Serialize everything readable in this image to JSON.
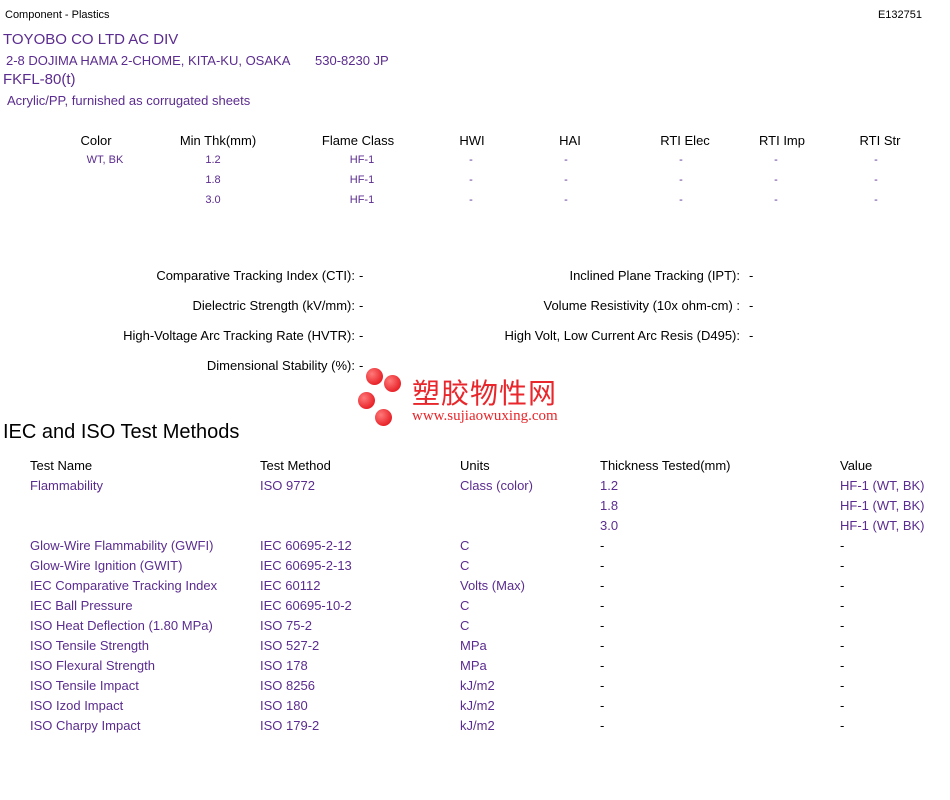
{
  "header": {
    "category": "Component - Plastics",
    "file_number": "E132751",
    "company": "TOYOBO CO LTD AC DIV",
    "address": "2-8 DOJIMA HAMA 2-CHOME, KITA-KU, OSAKA",
    "postal": "530-8230 JP",
    "product": "FKFL-80(t)",
    "description": "Acrylic/PP, furnished as corrugated sheets"
  },
  "ratings_table": {
    "headers": [
      "Color",
      "Min Thk(mm)",
      "Flame Class",
      "HWI",
      "HAI",
      "RTI Elec",
      "RTI Imp",
      "RTI Str"
    ],
    "rows": [
      [
        "WT, BK",
        "1.2",
        "HF-1",
        "-",
        "-",
        "-",
        "-",
        "-"
      ],
      [
        "",
        "1.8",
        "HF-1",
        "-",
        "-",
        "-",
        "-",
        "-"
      ],
      [
        "",
        "3.0",
        "HF-1",
        "-",
        "-",
        "-",
        "-",
        "-"
      ]
    ]
  },
  "properties": {
    "left": [
      {
        "label": "Comparative Tracking Index (CTI):",
        "value": "-"
      },
      {
        "label": "Dielectric Strength (kV/mm):",
        "value": "-"
      },
      {
        "label": "High-Voltage Arc Tracking Rate (HVTR):",
        "value": "-"
      },
      {
        "label": "Dimensional Stability (%):",
        "value": "-"
      }
    ],
    "right": [
      {
        "label": "Inclined Plane Tracking (IPT):",
        "value": "-"
      },
      {
        "label": "Volume Resistivity (10x ohm-cm) :",
        "value": "-"
      },
      {
        "label": "High Volt, Low Current Arc Resis (D495):",
        "value": "-"
      }
    ]
  },
  "watermark": {
    "text_cn": "塑胶物性网",
    "url": "www.sujiaowuxing.com",
    "color": "#e8262b"
  },
  "iec_section": {
    "title": "IEC and ISO Test Methods",
    "headers": [
      "Test Name",
      "Test Method",
      "Units",
      "Thickness Tested(mm)",
      "Value"
    ],
    "rows": [
      [
        "Flammability",
        "ISO 9772",
        "Class (color)",
        "1.2",
        "HF-1 (WT, BK)"
      ],
      [
        "",
        "",
        "",
        "1.8",
        "HF-1 (WT, BK)"
      ],
      [
        "",
        "",
        "",
        "3.0",
        "HF-1 (WT, BK)"
      ],
      [
        "Glow-Wire Flammability (GWFI)",
        "IEC 60695-2-12",
        "C",
        "-",
        "-"
      ],
      [
        "Glow-Wire Ignition (GWIT)",
        "IEC 60695-2-13",
        "C",
        "-",
        "-"
      ],
      [
        "IEC Comparative Tracking Index",
        "IEC 60112",
        "Volts (Max)",
        "-",
        "-"
      ],
      [
        "IEC Ball Pressure",
        "IEC 60695-10-2",
        "C",
        "-",
        "-"
      ],
      [
        "ISO Heat Deflection (1.80 MPa)",
        "ISO 75-2",
        "C",
        "-",
        "-"
      ],
      [
        "ISO Tensile Strength",
        "ISO 527-2",
        "MPa",
        "-",
        "-"
      ],
      [
        "ISO Flexural Strength",
        "ISO 178",
        "MPa",
        "-",
        "-"
      ],
      [
        "ISO Tensile Impact",
        "ISO 8256",
        "kJ/m2",
        "-",
        "-"
      ],
      [
        "ISO Izod Impact",
        "ISO 180",
        "kJ/m2",
        "-",
        "-"
      ],
      [
        "ISO Charpy Impact",
        "ISO 179-2",
        "kJ/m2",
        "-",
        "-"
      ]
    ]
  },
  "colors": {
    "accent": "#5b2c8f",
    "text": "#000000"
  }
}
